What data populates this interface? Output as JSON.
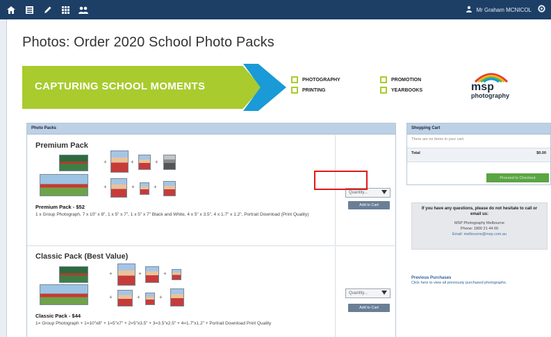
{
  "header": {
    "nav_icons": [
      "home-icon",
      "list-icon",
      "edit-icon",
      "grid-icon",
      "people-icon"
    ],
    "user_name": "Mr Graham MCNICOL",
    "user_icon": "person-icon"
  },
  "page": {
    "title": "Photos: Order 2020 School Photo Packs"
  },
  "banner": {
    "headline": "CAPTURING SCHOOL MOMENTS",
    "services": [
      "PHOTOGRAPHY",
      "PROMOTION",
      "PRINTING",
      "YEARBOOKS"
    ],
    "logo_top": "msp",
    "logo_bottom": "photography",
    "colors": {
      "green": "#a9cb2e",
      "blue": "#1a9ad6"
    }
  },
  "packs_panel": {
    "heading": "Photo Packs",
    "packs": [
      {
        "title": "Premium Pack",
        "name": "Premium Pack - $52",
        "description": "1 x Group Photograph, 7 x 10\" x 8\", 1 x 5\" x 7\", 1 x 5\" x 7\" Black and White, 4 x 5\" x 3.5\", 4 x 1.7\" x 1.2\", Portrait Download (Print Quality)",
        "quantity_placeholder": "Quantity...",
        "add_label": "Add to Cart"
      },
      {
        "title": "Classic Pack (Best Value)",
        "name": "Classic Pack - $44",
        "description": "1= Group Photograph + 1=10\"x8\" + 1=5\"x7\" + 2=5\"x3.5\" + 3=3.5\"x2.5\" + 4=1.7\"x1.2\" + Portrait Download Print Quality",
        "quantity_placeholder": "Quantity...",
        "add_label": "Add to Cart"
      }
    ]
  },
  "cart": {
    "heading": "Shopping Cart",
    "empty_text": "There are no items in your cart.",
    "total_label": "Total",
    "total_value": "$0.00",
    "checkout_label": "Proceed to Checkout"
  },
  "contact": {
    "question": "If you have any questions, please do not hesitate to call or email us:",
    "company": "MSP Photography Melbourne",
    "phone": "Phone: 1800 21 44 00",
    "email": "Email: melbourne@msp.com.au"
  },
  "previous": {
    "title": "Previous Purchases",
    "text": "Click here to view all previously purchased photographs."
  }
}
